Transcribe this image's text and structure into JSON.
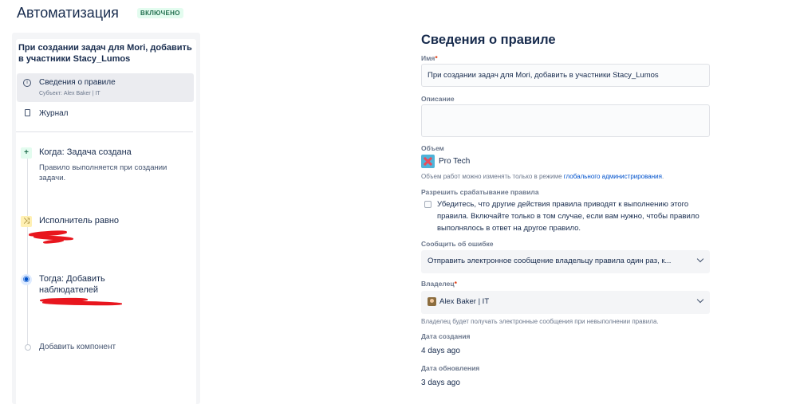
{
  "header": {
    "title": "Автоматизация",
    "status": "ВКЛЮЧЕНО"
  },
  "sidebar": {
    "rule_title": "При создании задач для Mori, добавить в участники Stacy_Lumos",
    "nav": {
      "details_label": "Сведения о правиле",
      "details_sub": "Субъект: Alex Baker | IT",
      "journal_label": "Журнал"
    },
    "steps": {
      "trigger_title": "Когда: Задача создана",
      "trigger_desc": "Правило выполняется при создании задачи.",
      "condition_title": "Исполнитель равно",
      "action_title": "Тогда: Добавить наблюдателей",
      "add_component": "Добавить компонент"
    }
  },
  "form": {
    "title": "Сведения о правиле",
    "name_label": "Имя",
    "required_mark": "*",
    "name_value": "При создании задач для Mori, добавить в участники Stacy_Lumos",
    "description_label": "Описание",
    "description_value": "",
    "scope_label": "Объем",
    "scope_value": "Pro Tech",
    "scope_helper_text": "Объем работ можно изменять только в режиме ",
    "scope_helper_link": "глобального администрирования",
    "scope_helper_end": ".",
    "allow_trigger_label": "Разрешить срабатывание правила",
    "allow_trigger_text": "Убедитесь, что другие действия правила приводят к выполнению этого правила. Включайте только в том случае, если вам нужно, чтобы правило выполнялось в ответ на другое правило.",
    "error_label": "Сообщить об ошибке",
    "error_value": "Отправить электронное сообщение владельцу правила один раз, к...",
    "owner_label": "Владелец",
    "owner_value": "Alex Baker | IT",
    "owner_helper": "Владелец будет получать электронные сообщения при невыполнении правила.",
    "created_label": "Дата создания",
    "created_value": "4 days ago",
    "updated_label": "Дата обновления",
    "updated_value": "3 days ago"
  },
  "colors": {
    "status_green": "#216e4e",
    "link_blue": "#0052cc",
    "redaction_red": "#e8161e"
  }
}
